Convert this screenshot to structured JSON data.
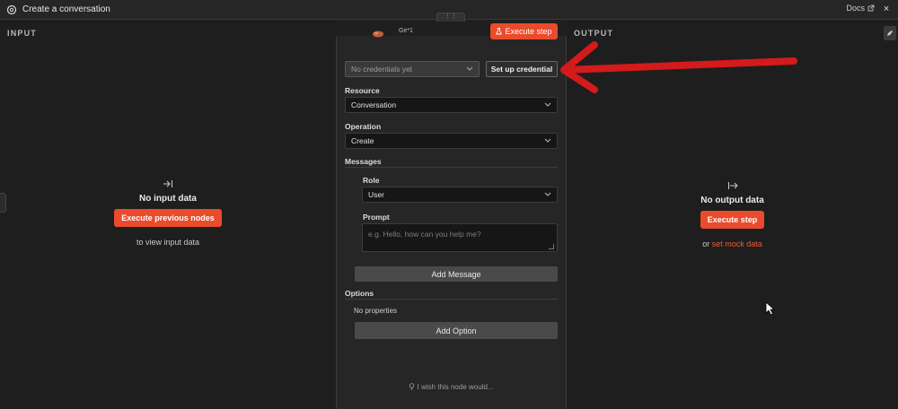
{
  "window": {
    "title": "Create a conversation",
    "docs_label": "Docs",
    "close_label": "×",
    "tab_handle": "⋮⋮"
  },
  "input_panel": {
    "label": "INPUT",
    "empty_title": "No input data",
    "button": "Execute previous nodes",
    "hint": "to view input data"
  },
  "output_panel": {
    "label": "OUTPUT",
    "empty_title": "No output data",
    "button": "Execute step",
    "hint_prefix": "or",
    "hint_link": "set mock data"
  },
  "node": {
    "name": "Ge*1",
    "execute_label": "Execute step",
    "credential_select": {
      "placeholder": "No credentials yet"
    },
    "credential_button": "Set up credential",
    "resource": {
      "label": "Resource",
      "value": "Conversation"
    },
    "operation": {
      "label": "Operation",
      "value": "Create"
    },
    "messages": {
      "label": "Messages",
      "role": {
        "label": "Role",
        "value": "User"
      },
      "prompt": {
        "label": "Prompt",
        "placeholder": "e.g. Hello, how can you help me?"
      },
      "add_button": "Add Message"
    },
    "options": {
      "label": "Options",
      "empty": "No properties",
      "add_button": "Add Option"
    },
    "wish": "I wish this node would..."
  },
  "colors": {
    "accent": "#ea4b2c",
    "arrow": "#d41a1a",
    "background": "#1f1f1f",
    "panel": "#262626"
  },
  "icons": {
    "app": "openai-logo-icon",
    "docs": "external-link-icon",
    "close": "close-icon",
    "input_empty": "arrow-to-right-bar-icon",
    "output_empty": "arrow-from-bar-right-icon",
    "edit": "pencil-icon",
    "flask": "flask-icon",
    "chevron": "chevron-down-icon",
    "bulb": "lightbulb-icon"
  }
}
